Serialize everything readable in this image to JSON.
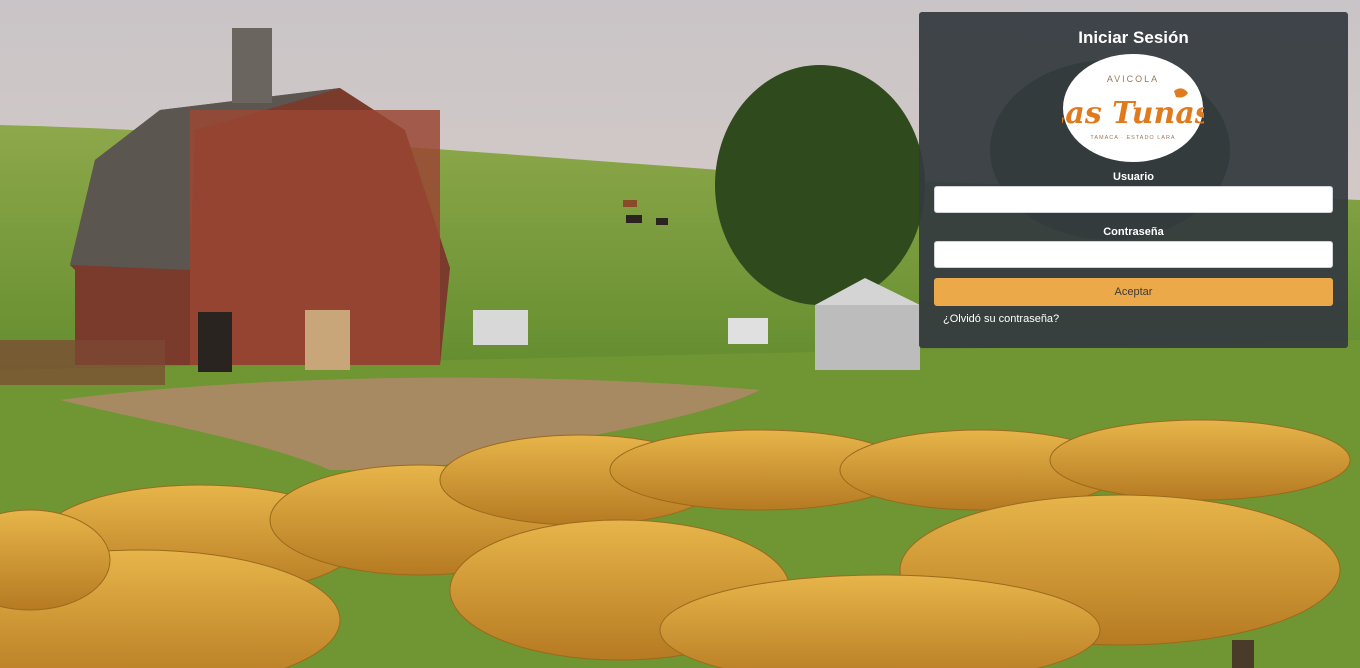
{
  "login": {
    "title": "Iniciar Sesión",
    "username_label": "Usuario",
    "username_value": "",
    "password_label": "Contraseña",
    "password_value": "",
    "accept_label": "Aceptar",
    "forgot_label": "¿Olvidó su contraseña?"
  },
  "logo": {
    "top_text": "AVICOLA",
    "brand": "Las Tunas",
    "bottom_text": "TAMACA · ESTADO LARA"
  },
  "colors": {
    "panel": "#343a40",
    "accent": "#eba94a",
    "logo_orange": "#e07a1e"
  }
}
